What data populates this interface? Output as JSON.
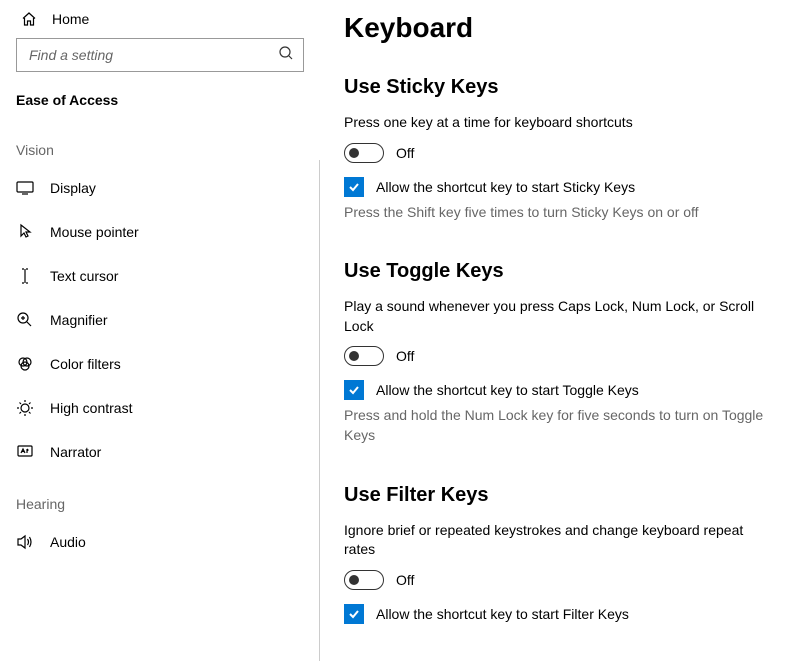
{
  "sidebar": {
    "home_label": "Home",
    "search_placeholder": "Find a setting",
    "group_label": "Ease of Access",
    "categories": {
      "vision": "Vision",
      "hearing": "Hearing"
    },
    "items": {
      "display": "Display",
      "mouse_pointer": "Mouse pointer",
      "text_cursor": "Text cursor",
      "magnifier": "Magnifier",
      "color_filters": "Color filters",
      "high_contrast": "High contrast",
      "narrator": "Narrator",
      "audio": "Audio"
    }
  },
  "main": {
    "title": "Keyboard",
    "sticky": {
      "heading": "Use Sticky Keys",
      "desc": "Press one key at a time for keyboard shortcuts",
      "toggle_state": "Off",
      "checkbox_label": "Allow the shortcut key to start Sticky Keys",
      "help": "Press the Shift key five times to turn Sticky Keys on or off"
    },
    "toggle": {
      "heading": "Use Toggle Keys",
      "desc": "Play a sound whenever you press Caps Lock, Num Lock, or Scroll Lock",
      "toggle_state": "Off",
      "checkbox_label": "Allow the shortcut key to start Toggle Keys",
      "help": "Press and hold the Num Lock key for five seconds to turn on Toggle Keys"
    },
    "filter": {
      "heading": "Use Filter Keys",
      "desc": "Ignore brief or repeated keystrokes and change keyboard repeat rates",
      "toggle_state": "Off",
      "checkbox_label": "Allow the shortcut key to start Filter Keys"
    }
  }
}
